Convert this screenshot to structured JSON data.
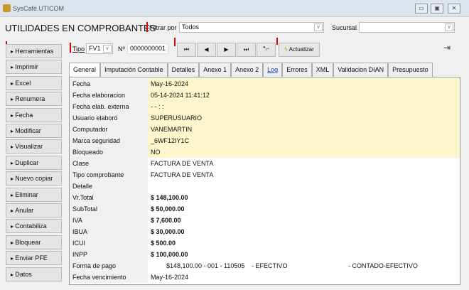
{
  "window": {
    "title": "SysCafé.UTICOM",
    "min": "▭",
    "max": "▣",
    "close": "✕"
  },
  "header": {
    "title": "UTILIDADES EN COMPROBANTES",
    "filter_label": "Filtrar por",
    "filter_value": "Todos",
    "sucursal_label": "Sucursal",
    "sucursal_value": ""
  },
  "toolbar": {
    "tipo_label": "Tipo",
    "tipo_value": "FV1",
    "num_label": "Nº",
    "num_value": "0000000001",
    "first": "⏮",
    "prev": "◀",
    "next": "▶",
    "last": "⏭",
    "find": "🔭",
    "refresh": "Actualizar",
    "exit": "⇥"
  },
  "sidebar": [
    "Herramientas",
    "Imprimir",
    "Excel",
    "Renumera",
    "Fecha",
    "Modificar",
    "Visualizar",
    "Duplicar",
    "Nuevo copiar",
    "Eliminar",
    "Anular",
    "Contabiliza",
    "Bloquear",
    "Enviar PFE",
    "Datos"
  ],
  "tabs": [
    "General",
    "Imputación Contable",
    "Detalles",
    "Anexo 1",
    "Anexo 2",
    "Log",
    "Errores",
    "XML",
    "Validacion DIAN",
    "Presupuesto"
  ],
  "rows": [
    {
      "k": "Fecha",
      "v": "May-16-2024"
    },
    {
      "k": "Fecha elaboracion",
      "v": "05-14-2024 11:41:12"
    },
    {
      "k": "Fecha elab. externa",
      "v": "  -  -        :  :"
    },
    {
      "k": "Usuario elaboró",
      "v": "SUPERUSUARIO"
    },
    {
      "k": "Computador",
      "v": "VANEMARTIN"
    },
    {
      "k": "Marca seguridad",
      "v": "_6WF12IY1C"
    },
    {
      "k": "Bloqueado",
      "v": "NO"
    },
    {
      "k": "Clase",
      "v": "FACTURA DE VENTA"
    },
    {
      "k": "Tipo comprobante",
      "v": "FACTURA DE VENTA"
    },
    {
      "k": "Detalle",
      "v": ""
    },
    {
      "k": "Vr.Total",
      "v": "$ 148,100.00"
    },
    {
      "k": "SubTotal",
      "v": "$ 50,000.00"
    },
    {
      "k": "IVA",
      "v": "$ 7,600.00"
    },
    {
      "k": "IBUA",
      "v": "$ 30,000.00"
    },
    {
      "k": "ICUI",
      "v": "$ 500.00"
    },
    {
      "k": "INPP",
      "v": "$ 100,000.00"
    },
    {
      "k": "Forma de pago",
      "v": "$148,100.00 - 001 - 110505",
      "v2": "- EFECTIVO",
      "v3": "- CONTADO-EFECTIVO"
    },
    {
      "k": "Fecha vencimiento",
      "v": "May-16-2024"
    }
  ]
}
